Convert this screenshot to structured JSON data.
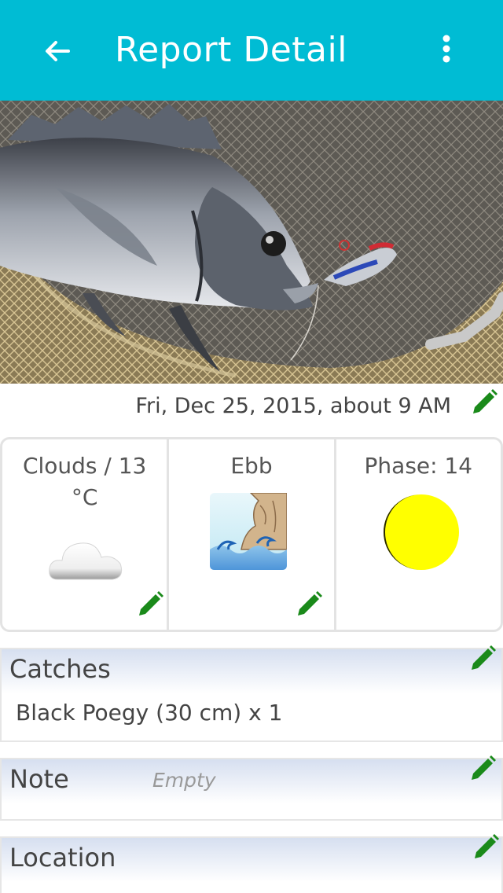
{
  "appbar": {
    "title": "Report Detail",
    "back_icon": "arrow-back-icon",
    "menu_icon": "more-vert-icon",
    "color": "#00bcd4"
  },
  "photo": {
    "subject": "fish-photo"
  },
  "report": {
    "datetime": "Fri, Dec 25, 2015, about 9 AM"
  },
  "conditions": {
    "weather": {
      "label": "Clouds / 13 °C",
      "icon": "cloud-icon"
    },
    "tide": {
      "label": "Ebb",
      "icon": "tide-wave-icon"
    },
    "moon": {
      "label": "Phase: 14",
      "icon": "moon-phase-icon"
    }
  },
  "catches": {
    "heading": "Catches",
    "items": [
      "Black Poegy (30 cm) x 1"
    ]
  },
  "note": {
    "heading": "Note",
    "placeholder": "Empty"
  },
  "location": {
    "heading": "Location"
  },
  "colors": {
    "edit_icon": "#1a8a1a",
    "moon": "#ffff00"
  }
}
